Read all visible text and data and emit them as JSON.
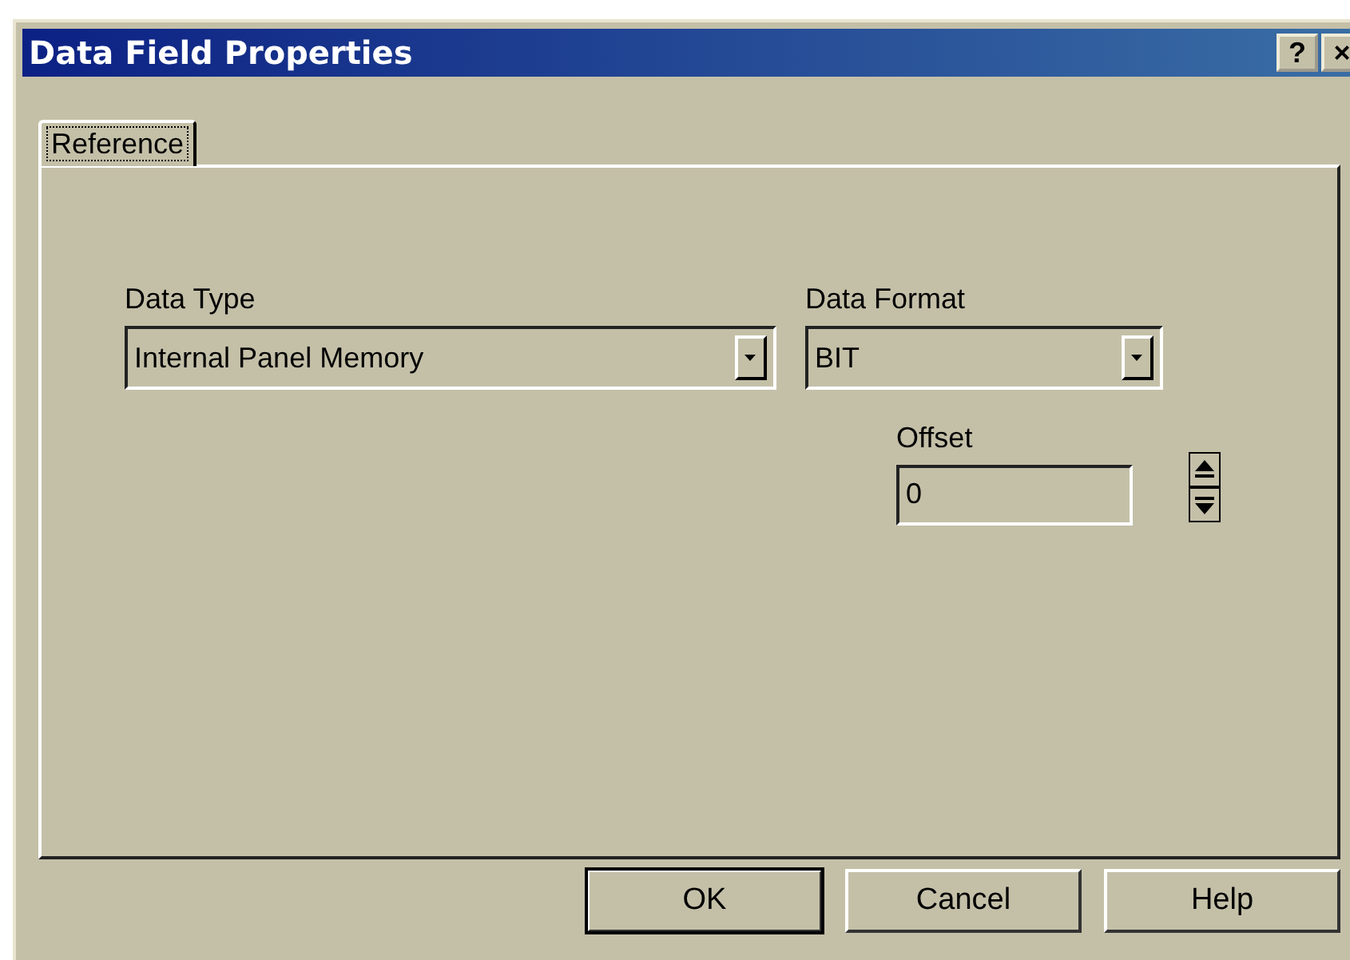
{
  "window": {
    "title": "Data Field Properties",
    "title_buttons": [
      "?",
      "×"
    ]
  },
  "tabs": [
    {
      "label": "Reference",
      "selected": true
    }
  ],
  "fields": [
    {
      "label": "Data Type",
      "value": "Internal Panel Memory",
      "kind": "dropdown"
    },
    {
      "label": "Data Format",
      "value": "BIT",
      "kind": "dropdown"
    },
    {
      "label": "Offset",
      "value": "0",
      "kind": "spinner"
    }
  ],
  "buttons": [
    {
      "label": "OK",
      "default": true
    },
    {
      "label": "Cancel",
      "default": false
    },
    {
      "label": "Help",
      "default": false
    }
  ]
}
